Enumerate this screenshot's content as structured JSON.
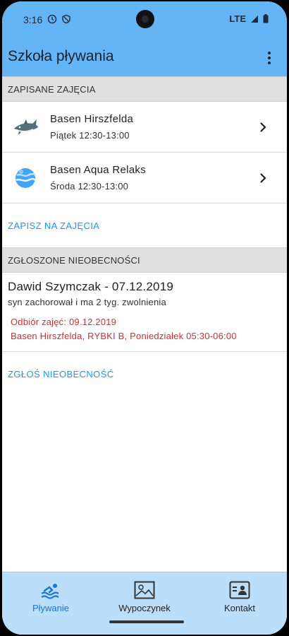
{
  "status_bar": {
    "time": "3:16",
    "network": "LTE"
  },
  "app_bar": {
    "title": "Szkoła pływania",
    "menu_icon": "more-vert-icon"
  },
  "enrolled": {
    "header": "ZAPISANE ZAJĘCIA",
    "items": [
      {
        "title": "Basen Hirszfelda",
        "schedule": "Piątek 12:30-13:00",
        "icon": "shark-icon"
      },
      {
        "title": "Basen Aqua Relaks",
        "schedule": "Środa 12:30-13:00",
        "icon": "water-globe-icon"
      }
    ],
    "action": "ZAPISZ NA ZAJĘCIA"
  },
  "absences": {
    "header": "ZGŁOSZONE NIEOBECNOŚCI",
    "items": [
      {
        "title": "Dawid Szymczak - 07.12.2019",
        "note": "syn zachorował i ma 2 tyg. zwolnienia",
        "makeup": "Odbiór zajęć: 09.12.2019",
        "makeup_details": "Basen Hirszfelda, RYBKI B, Poniedziałek 05:30-06:00"
      }
    ],
    "action": "ZGŁOŚ NIEOBECNOŚĆ"
  },
  "bottom_nav": {
    "items": [
      {
        "label": "Pływanie",
        "icon": "swimmer-icon",
        "active": true
      },
      {
        "label": "Wypoczynek",
        "icon": "landscape-icon",
        "active": false
      },
      {
        "label": "Kontakt",
        "icon": "contact-card-icon",
        "active": false
      }
    ]
  },
  "colors": {
    "app_bar": "#64b5f6",
    "bottom_nav": "#bbdefb",
    "link": "#2196f3",
    "alert": "#d32f2f"
  }
}
